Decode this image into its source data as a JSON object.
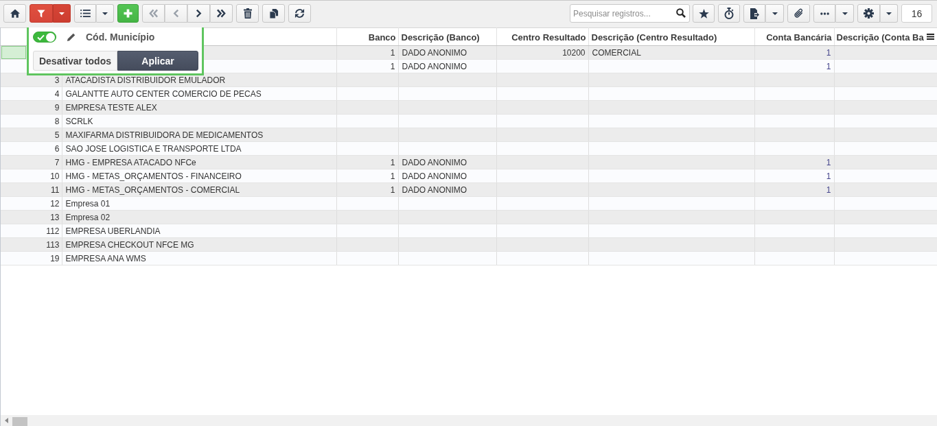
{
  "toolbar": {
    "filter_active": true,
    "navigation": [
      {
        "disabled": true
      },
      {
        "disabled": true
      },
      {
        "disabled": false
      },
      {
        "disabled": false
      }
    ],
    "search": {
      "placeholder": "Pesquisar registros..."
    },
    "record_count": "16"
  },
  "filter_popup": {
    "field": {
      "label": "Cód. Município",
      "on": true
    },
    "buttons": [
      {
        "label": "Desativar todos",
        "kind": "secondary"
      },
      {
        "label": "Aplicar",
        "kind": "primary"
      }
    ]
  },
  "table": {
    "columns": [
      "Banco",
      "Descrição (Banco)",
      "Centro Resultado",
      "Descrição (Centro Resultado)",
      "Conta Bancária",
      "Descrição (Conta Ba"
    ],
    "rows": [
      {
        "selected": true,
        "banco": "1",
        "descricao_banco": "DADO ANONIMO",
        "centro_resultado": "10200",
        "descricao_centro_resultado": "COMERCIAL",
        "conta_bancaria": "1"
      },
      {
        "selected": false,
        "banco": "1",
        "descricao_banco": "DADO ANONIMO",
        "conta_bancaria": "1"
      },
      {
        "selected": false,
        "code": "3",
        "name": "ATACADISTA DISTRIBUIDOR EMULADOR"
      },
      {
        "selected": false,
        "code": "4",
        "name": "GALANTTE AUTO CENTER COMERCIO DE PECAS"
      },
      {
        "selected": false,
        "code": "9",
        "name": "EMPRESA TESTE ALEX"
      },
      {
        "selected": false,
        "code": "8",
        "name": "SCRLK"
      },
      {
        "selected": false,
        "code": "5",
        "name": "MAXIFARMA DISTRIBUIDORA DE MEDICAMENTOS"
      },
      {
        "selected": false,
        "code": "6",
        "name": "SAO JOSE LOGISTICA E TRANSPORTE LTDA"
      },
      {
        "selected": false,
        "code": "7",
        "name": "HMG - EMPRESA ATACADO NFCe",
        "banco": "1",
        "descricao_banco": "DADO ANONIMO",
        "conta_bancaria": "1"
      },
      {
        "selected": false,
        "code": "10",
        "name": "HMG - METAS_ORÇAMENTOS - FINANCEIRO",
        "banco": "1",
        "descricao_banco": "DADO ANONIMO",
        "conta_bancaria": "1"
      },
      {
        "selected": false,
        "code": "11",
        "name": "HMG - METAS_ORÇAMENTOS - COMERCIAL",
        "banco": "1",
        "descricao_banco": "DADO ANONIMO",
        "conta_bancaria": "1"
      },
      {
        "selected": false,
        "code": "12",
        "name": "Empresa 01"
      },
      {
        "selected": false,
        "code": "13",
        "name": "Empresa 02"
      },
      {
        "selected": false,
        "code": "112",
        "name": "EMPRESA UBERLANDIA"
      },
      {
        "selected": false,
        "code": "113",
        "name": "EMPRESA CHECKOUT NFCE MG"
      },
      {
        "selected": false,
        "code": "19",
        "name": "EMPRESA ANA WMS"
      }
    ]
  }
}
